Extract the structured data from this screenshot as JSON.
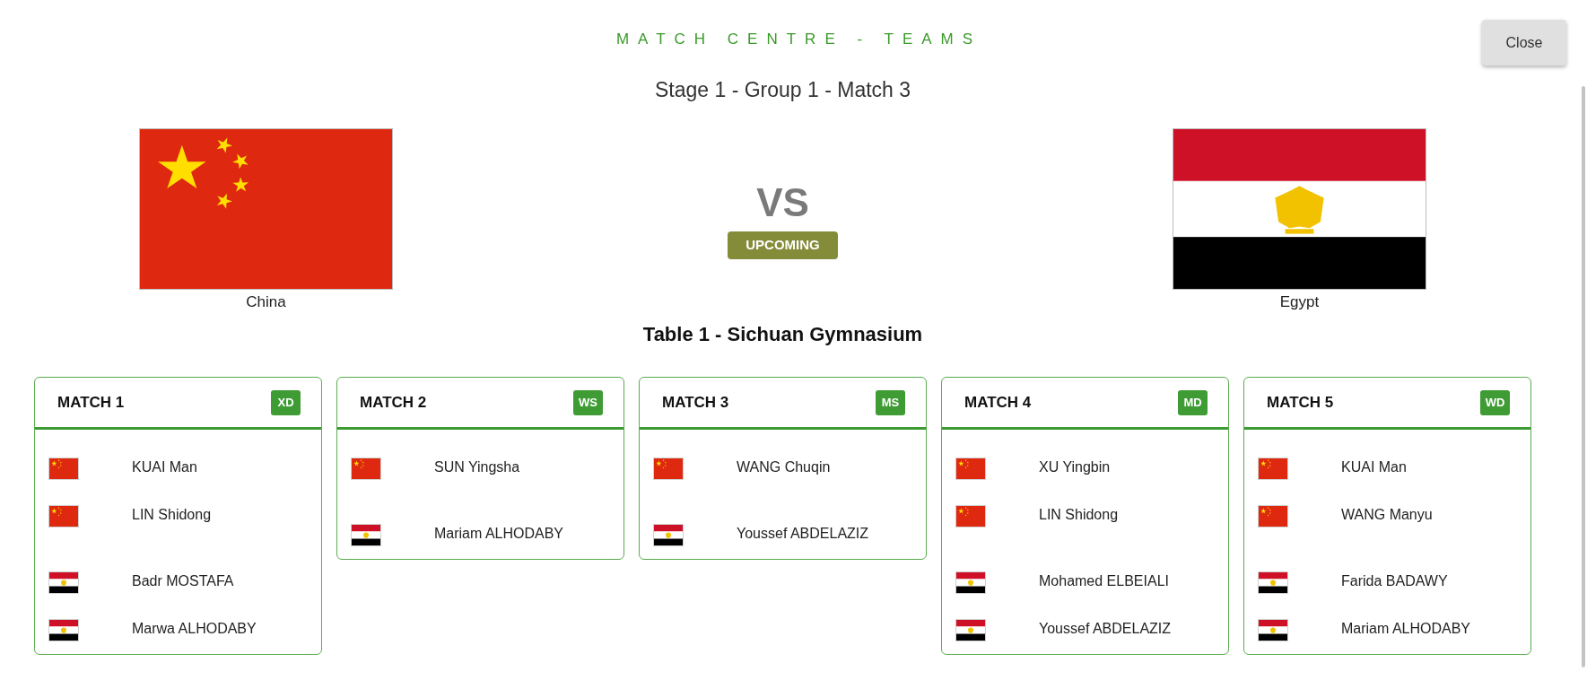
{
  "header": {
    "title": "MATCH CENTRE - TEAMS",
    "close_button": "Close"
  },
  "subtitle": "Stage 1 - Group 1 - Match 3",
  "teams": [
    {
      "name": "China",
      "kind": "china"
    },
    {
      "name": "Egypt",
      "kind": "egypt"
    }
  ],
  "versus": {
    "label": "VS",
    "status": "UPCOMING"
  },
  "venue": "Table 1 - Sichuan Gymnasium",
  "matches": [
    {
      "title": "MATCH 1",
      "event": "XD",
      "sides": [
        {
          "players": [
            {
              "name": "KUAI Man",
              "kind": "china"
            },
            {
              "name": "LIN Shidong",
              "kind": "china"
            }
          ]
        },
        {
          "players": [
            {
              "name": "Badr MOSTAFA",
              "kind": "egypt"
            },
            {
              "name": "Marwa ALHODABY",
              "kind": "egypt"
            }
          ]
        }
      ]
    },
    {
      "title": "MATCH 2",
      "event": "WS",
      "sides": [
        {
          "players": [
            {
              "name": "SUN Yingsha",
              "kind": "china"
            }
          ]
        },
        {
          "players": [
            {
              "name": "Mariam ALHODABY",
              "kind": "egypt"
            }
          ]
        }
      ]
    },
    {
      "title": "MATCH 3",
      "event": "MS",
      "sides": [
        {
          "players": [
            {
              "name": "WANG Chuqin",
              "kind": "china"
            }
          ]
        },
        {
          "players": [
            {
              "name": "Youssef ABDELAZIZ",
              "kind": "egypt"
            }
          ]
        }
      ]
    },
    {
      "title": "MATCH 4",
      "event": "MD",
      "sides": [
        {
          "players": [
            {
              "name": "XU Yingbin",
              "kind": "china"
            },
            {
              "name": "LIN Shidong",
              "kind": "china"
            }
          ]
        },
        {
          "players": [
            {
              "name": "Mohamed ELBEIALI",
              "kind": "egypt"
            },
            {
              "name": "Youssef ABDELAZIZ",
              "kind": "egypt"
            }
          ]
        }
      ]
    },
    {
      "title": "MATCH 5",
      "event": "WD",
      "sides": [
        {
          "players": [
            {
              "name": "KUAI Man",
              "kind": "china"
            },
            {
              "name": "WANG Manyu",
              "kind": "china"
            }
          ]
        },
        {
          "players": [
            {
              "name": "Farida BADAWY",
              "kind": "egypt"
            },
            {
              "name": "Mariam ALHODABY",
              "kind": "egypt"
            }
          ]
        }
      ]
    }
  ]
}
